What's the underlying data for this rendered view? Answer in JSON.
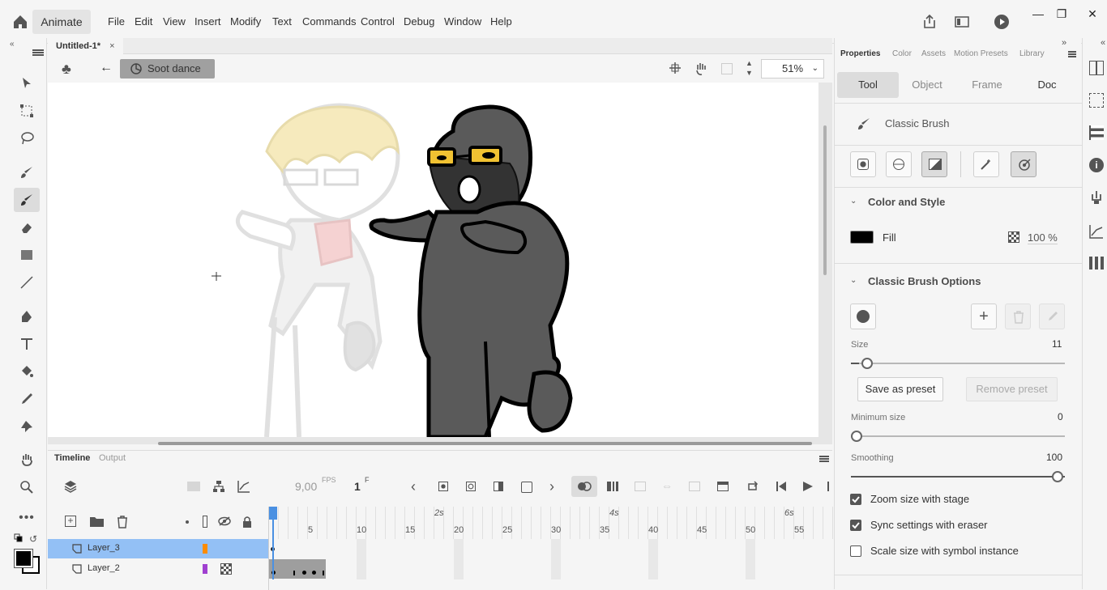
{
  "app": {
    "name": "Animate"
  },
  "menu": [
    "File",
    "Edit",
    "View",
    "Insert",
    "Modify",
    "Text",
    "Commands",
    "Control",
    "Debug",
    "Window",
    "Help"
  ],
  "document": {
    "tab": "Untitled-1*",
    "scene": "Soot dance",
    "zoom": "51%"
  },
  "timeline": {
    "tabs": {
      "timeline": "Timeline",
      "output": "Output"
    },
    "fps": "9,00",
    "fps_unit": "FPS",
    "frame": "1",
    "frame_unit": "F",
    "ruler_seconds": [
      "2s",
      "4s",
      "6s"
    ],
    "ruler_frames": [
      "5",
      "10",
      "15",
      "20",
      "25",
      "30",
      "35",
      "40",
      "45",
      "50",
      "55"
    ],
    "layers": [
      {
        "name": "Layer_3",
        "color": "#ff8c00",
        "selected": true
      },
      {
        "name": "Layer_2",
        "color": "#a040d0",
        "selected": false
      }
    ]
  },
  "properties": {
    "tabs": [
      "Properties",
      "Color",
      "Assets",
      "Motion Presets",
      "Library"
    ],
    "segments": [
      "Tool",
      "Object",
      "Frame",
      "Doc"
    ],
    "tool_name": "Classic Brush",
    "color_section": "Color and Style",
    "fill_label": "Fill",
    "fill_color": "#000000",
    "fill_alpha": "100 %",
    "brush_section": "Classic Brush Options",
    "size_label": "Size",
    "size_value": "11",
    "save_preset": "Save as preset",
    "remove_preset": "Remove preset",
    "min_size_label": "Minimum size",
    "min_size_value": "0",
    "smoothing_label": "Smoothing",
    "smoothing_value": "100",
    "checkboxes": [
      {
        "label": "Zoom size with stage",
        "checked": true
      },
      {
        "label": "Sync settings with eraser",
        "checked": true
      },
      {
        "label": "Scale size with symbol instance",
        "checked": false
      }
    ]
  },
  "colors": {
    "accent": "#2680eb",
    "layer_selected": "#93c0f5",
    "playhead": "#4a90e2"
  }
}
